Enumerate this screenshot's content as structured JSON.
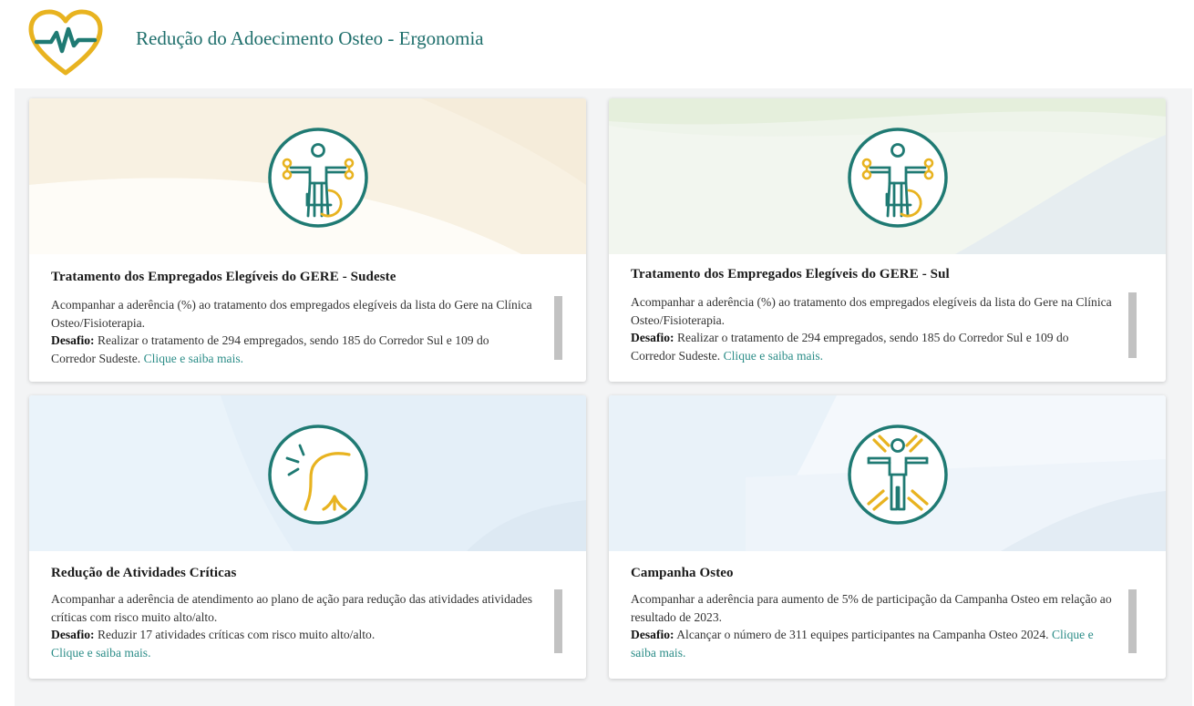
{
  "header": {
    "title": "Redução do Adoecimento Osteo - Ergonomia",
    "logo_icon": "heart-pulse-icon"
  },
  "colors": {
    "brand_teal": "#1f7a73",
    "brand_gold": "#e8b320",
    "link": "#2c8d88",
    "scrollbar": "#c2c2c2"
  },
  "cards": [
    {
      "icon": "person-wheelchair-exercise-icon",
      "title": "Tratamento dos Empregados Elegíveis do GERE - Sudeste",
      "description": "Acompanhar a aderência (%) ao tratamento dos empregados elegíveis da lista do Gere na Clínica Osteo/Fisioterapia.",
      "challenge_label": "Desafio:",
      "challenge_text": " Realizar o tratamento de 294 empregados, sendo 185 do Corredor Sul e 109 do Corredor Sudeste.",
      "link": " Clique e saiba mais."
    },
    {
      "icon": "person-wheelchair-exercise-icon",
      "title": "Tratamento dos Empregados Elegíveis do GERE - Sul",
      "description": "Acompanhar a aderência (%) ao tratamento dos empregados elegíveis da lista do Gere na Clínica Osteo/Fisioterapia.",
      "challenge_label": "Desafio:",
      "challenge_text": " Realizar o tratamento de 294 empregados, sendo 185 do Corredor Sul e 109 do Corredor Sudeste.",
      "link": " Clique e saiba mais."
    },
    {
      "icon": "shoulder-pain-icon",
      "title": "Redução de Atividades Críticas",
      "description": "Acompanhar a aderência de atendimento ao plano de ação para redução das atividades atividades críticas com risco muito alto/alto.",
      "challenge_label": "Desafio:",
      "challenge_text": " Reduzir 17  atividades críticas com risco muito alto/alto.",
      "link": "Clique e saiba mais."
    },
    {
      "icon": "person-stretching-icon",
      "title": "Campanha Osteo",
      "description": "Acompanhar a aderência para aumento de 5% de participação da Campanha Osteo em relação ao resultado de 2023.",
      "challenge_label": "Desafio:",
      "challenge_text": " Alcançar o número de 311 equipes participantes na Campanha Osteo 2024.",
      "link": " Clique e saiba mais."
    }
  ]
}
